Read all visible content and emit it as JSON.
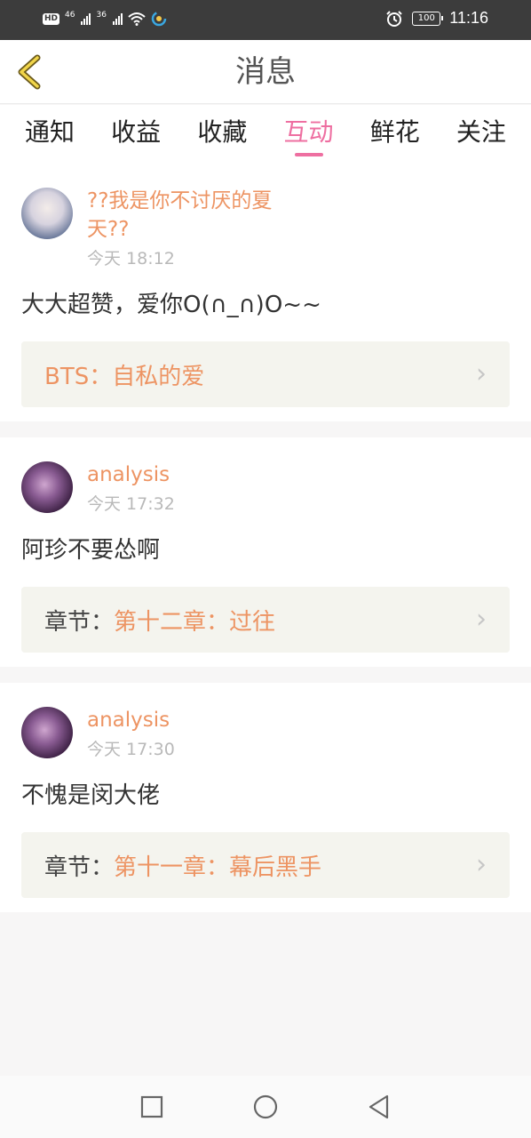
{
  "status_bar": {
    "hd": "HD",
    "net1": "46",
    "net2": "36",
    "battery": "100",
    "time": "11:16"
  },
  "header": {
    "title": "消息",
    "back_icon": "chevron-left-icon"
  },
  "tabs": [
    {
      "label": "通知",
      "active": false
    },
    {
      "label": "收益",
      "active": false
    },
    {
      "label": "收藏",
      "active": false
    },
    {
      "label": "互动",
      "active": true
    },
    {
      "label": "鲜花",
      "active": false
    },
    {
      "label": "关注",
      "active": false
    }
  ],
  "messages": [
    {
      "username": "??我是你不讨厌的夏天??",
      "time": "今天 18:12",
      "comment": "大大超赞，爱你O(∩_∩)O~~",
      "ref_book": "BTS：自私的爱"
    },
    {
      "username": "analysis",
      "time": "今天 17:32",
      "comment": "阿珍不要怂啊",
      "ref_label": "章节：",
      "ref_value": "第十二章：过往"
    },
    {
      "username": "analysis",
      "time": "今天 17:30",
      "comment": "不愧是闵大佬",
      "ref_label": "章节：",
      "ref_value": "第十一章：幕后黑手"
    }
  ],
  "colors": {
    "accent_pink": "#ee6fa1",
    "accent_orange": "#ed9463"
  }
}
